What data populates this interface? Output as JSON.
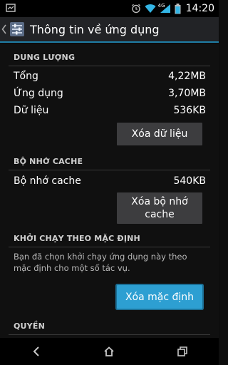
{
  "status_bar": {
    "time": "14:20",
    "icons": [
      "notification-icon",
      "alarm-icon",
      "wifi-icon",
      "signal-4g-icon",
      "battery-icon"
    ],
    "network_label": "4G"
  },
  "action_bar": {
    "title": "Thông tin về ứng dụng",
    "app_icon": "settings-app-icon"
  },
  "storage": {
    "header": "DUNG LƯỢNG",
    "rows": [
      {
        "label": "Tổng",
        "value": "4,22MB"
      },
      {
        "label": "Ứng dụng",
        "value": "3,70MB"
      },
      {
        "label": "Dữ liệu",
        "value": "536KB"
      }
    ],
    "clear_data_button": "Xóa dữ liệu"
  },
  "cache": {
    "header": "BỘ NHỚ CACHE",
    "row": {
      "label": "Bộ nhớ cache",
      "value": "540KB"
    },
    "clear_cache_button_line1": "Xóa bộ nhớ",
    "clear_cache_button_line2": "cache"
  },
  "launch_default": {
    "header": "KHỞI CHẠY THEO MẶC ĐỊNH",
    "description": "Bạn đã chọn khởi chạy ứng dụng này theo mặc định cho một số tác vụ.",
    "clear_defaults_button": "Xóa mặc định"
  },
  "permissions": {
    "header": "QUYỀN"
  },
  "nav_bar": {
    "icons": [
      "back-icon",
      "home-icon",
      "recent-apps-icon"
    ]
  },
  "colors": {
    "accent": "#2d9fd2",
    "background": "#101010",
    "button": "#3d3d3f"
  }
}
